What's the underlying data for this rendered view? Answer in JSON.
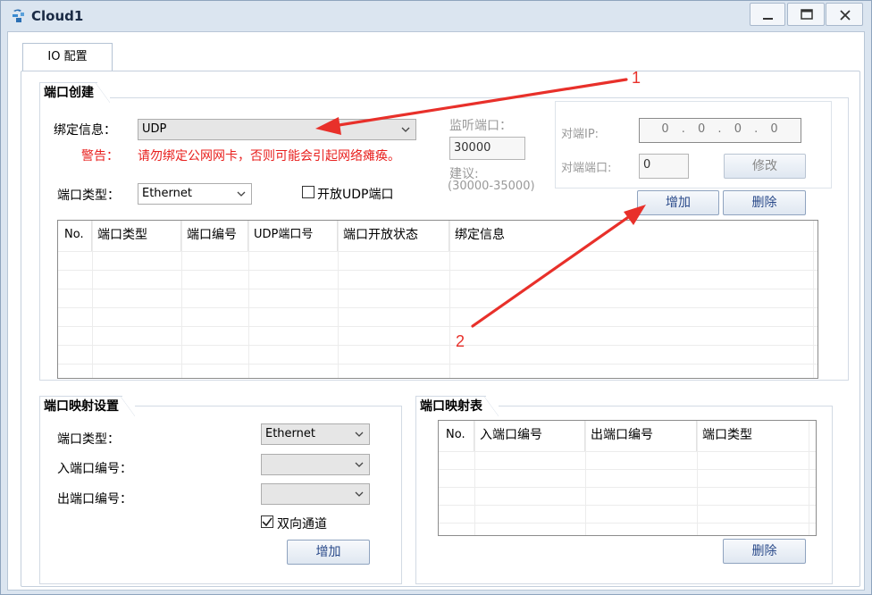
{
  "window": {
    "title": "Cloud1"
  },
  "tabs": [
    {
      "label": "IO 配置"
    }
  ],
  "port_create": {
    "title": "端口创建",
    "bind_label": "绑定信息：",
    "bind_value": "UDP",
    "warning_label": "警告：",
    "warning_text": "请勿绑定公网网卡，否则可能会引起网络瘫痪。",
    "port_type_label": "端口类型：",
    "port_type_value": "Ethernet",
    "open_udp_label": "开放UDP端口",
    "open_udp_checked": false,
    "listen_port_label": "监听端口：",
    "listen_port_value": "30000",
    "suggest_label": "建议:",
    "suggest_range": "(30000-35000)",
    "peer_ip_label": "对端IP:",
    "peer_ip_value": "0 . 0 . 0 . 0",
    "peer_port_label": "对端端口:",
    "peer_port_value": "0",
    "modify_button": "修改",
    "add_button": "增加",
    "delete_button": "删除",
    "table_headers": [
      "No.",
      "端口类型",
      "端口编号",
      "UDP端口号",
      "端口开放状态",
      "绑定信息"
    ]
  },
  "port_map_settings": {
    "title": "端口映射设置",
    "port_type_label": "端口类型：",
    "port_type_value": "Ethernet",
    "in_port_label": "入端口编号：",
    "in_port_value": "",
    "out_port_label": "出端口编号：",
    "out_port_value": "",
    "bidirectional_label": "双向通道",
    "bidirectional_checked": true,
    "add_button": "增加"
  },
  "port_map_table": {
    "title": "端口映射表",
    "table_headers": [
      "No.",
      "入端口编号",
      "出端口编号",
      "端口类型"
    ],
    "delete_button": "删除"
  },
  "annotations": [
    {
      "text": "1"
    },
    {
      "text": "2"
    }
  ],
  "colors": {
    "arrow": "#e8302a",
    "warning": "#e8201e",
    "button_text": "#2a4a8a"
  }
}
